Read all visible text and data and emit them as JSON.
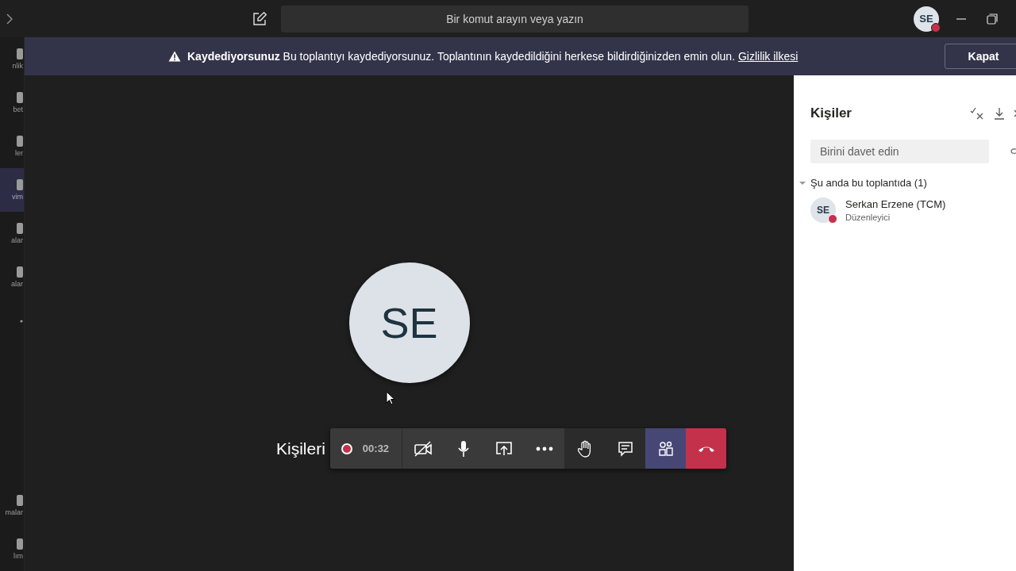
{
  "topbar": {
    "search": {
      "placeholder": "Bir komut arayın veya yazın"
    },
    "avatar": {
      "initials": "SE",
      "busy": true
    }
  },
  "sidebar": {
    "items": [
      {
        "kind": "app",
        "label": "nlik",
        "selected": false
      },
      {
        "kind": "app",
        "label": "bet",
        "selected": false
      },
      {
        "kind": "app",
        "label": "ler",
        "selected": false
      },
      {
        "kind": "app",
        "label": "vim",
        "selected": true
      },
      {
        "kind": "app",
        "label": "alar",
        "selected": false
      },
      {
        "kind": "app",
        "label": "alar",
        "selected": false
      },
      {
        "kind": "more",
        "selected": false
      }
    ],
    "bottom_items": [
      {
        "kind": "app",
        "label": "malar",
        "selected": false
      },
      {
        "kind": "app",
        "label": "lım",
        "selected": false
      }
    ]
  },
  "banner": {
    "title": "Kaydediyorsunuz",
    "message": "Bu toplantıyı kaydediyorsunuz. Toplantının kaydedildiğini herkese bildirdiğinizden emin olun.",
    "link": "Gizlilik ilkesi",
    "button": "Kapat"
  },
  "stage": {
    "avatar": "SE",
    "invite_hint": "Kişileri"
  },
  "toolbar": {
    "recording": true,
    "timer": "00:32",
    "sections": [
      {
        "kind": "media",
        "buttons": [
          {
            "kind": "camera-off",
            "selected": false
          },
          {
            "kind": "mic",
            "selected": false
          },
          {
            "kind": "share",
            "selected": false
          },
          {
            "kind": "more",
            "selected": false
          }
        ]
      },
      {
        "kind": "actions",
        "buttons": [
          {
            "kind": "hand",
            "selected": false
          },
          {
            "kind": "chat",
            "selected": false
          }
        ]
      },
      {
        "kind": "panel",
        "buttons": [
          {
            "kind": "people",
            "selected": true
          }
        ]
      },
      {
        "kind": "leave",
        "buttons": [
          {
            "kind": "hangup",
            "selected": false
          }
        ]
      }
    ]
  },
  "panel": {
    "title": "Kişiler",
    "invite": {
      "placeholder": "Birini davet edin"
    },
    "groups": [
      {
        "title": "Şu anda bu toplantıda (1)",
        "expanded": true,
        "participants": [
          {
            "initials": "SE",
            "name": "Serkan Erzene (TCM)",
            "role": "Düzenleyici",
            "busy": true
          }
        ]
      }
    ]
  }
}
